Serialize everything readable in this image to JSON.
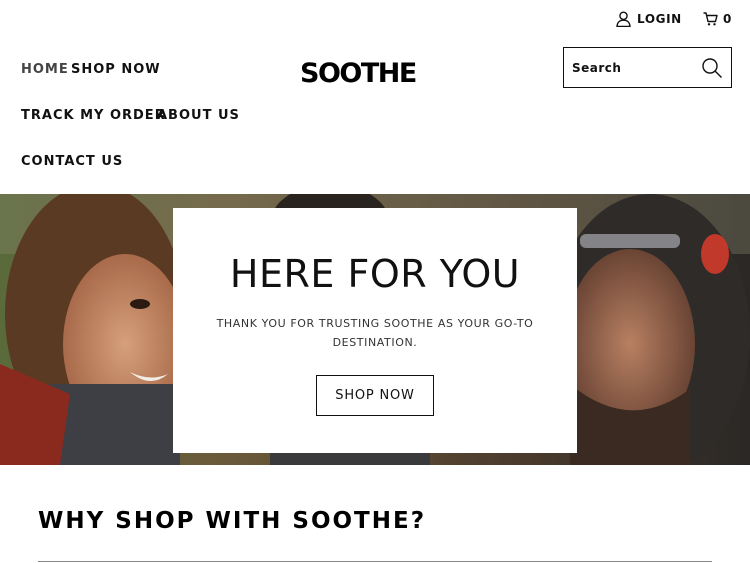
{
  "header": {
    "login_label": "LOGIN",
    "cart_count": "0",
    "logo": "SOOTHE",
    "search_placeholder": "Search"
  },
  "nav": {
    "items": [
      {
        "label": "HOME"
      },
      {
        "label": "SHOP NOW"
      },
      {
        "label": "TRACK MY ORDER"
      },
      {
        "label": "ABOUT US"
      },
      {
        "label": "CONTACT US"
      }
    ]
  },
  "hero": {
    "title": "HERE FOR YOU",
    "subtitle": "THANK YOU FOR TRUSTING SOOTHE AS YOUR GO-TO DESTINATION.",
    "button_label": "SHOP NOW"
  },
  "section": {
    "heading": "WHY SHOP WITH SOOTHE?"
  },
  "icons": [
    "user-icon",
    "cart-icon",
    "search-icon"
  ],
  "colors": {
    "text": "#111111",
    "background": "#ffffff",
    "divider": "#888888"
  }
}
